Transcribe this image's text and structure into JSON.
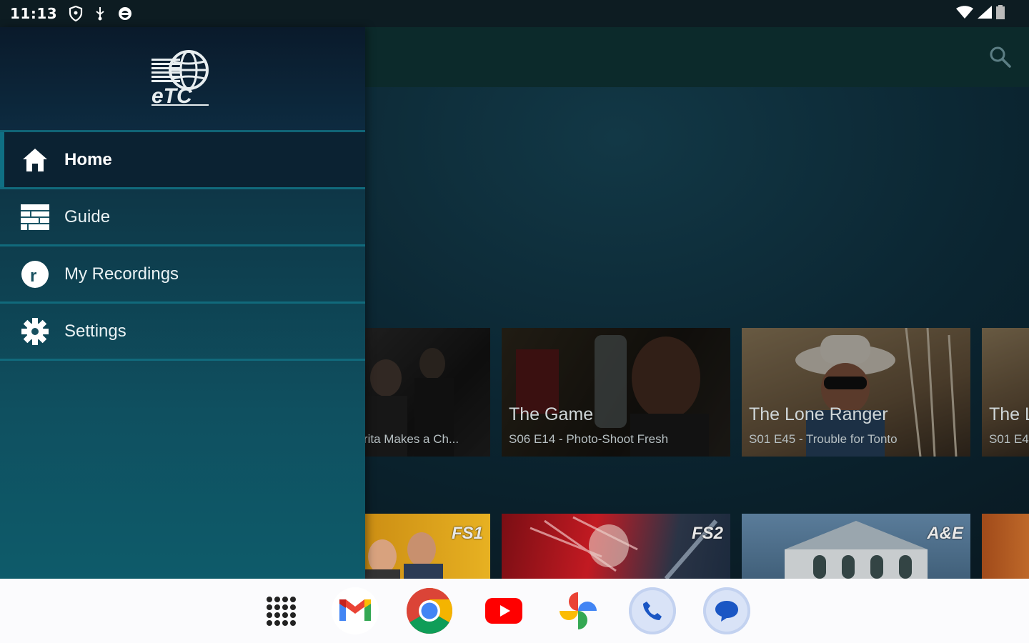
{
  "status_bar": {
    "time": "11:13"
  },
  "drawer": {
    "logo_alt": "ETC",
    "items": [
      {
        "label": "Home",
        "icon": "home-icon",
        "active": true
      },
      {
        "label": "Guide",
        "icon": "guide-icon",
        "active": false
      },
      {
        "label": "My Recordings",
        "icon": "recordings-icon",
        "active": false
      },
      {
        "label": "Settings",
        "icon": "gear-icon",
        "active": false
      }
    ]
  },
  "content": {
    "row1": [
      {
        "title": "",
        "subtitle": "ñorita Makes a Ch..."
      },
      {
        "title": "The Game",
        "subtitle": "S06 E14 - Photo-Shoot Fresh"
      },
      {
        "title": "The Lone Ranger",
        "subtitle": "S01 E45 - Trouble for Tonto"
      },
      {
        "title": "The L",
        "subtitle": "S01 E4"
      }
    ],
    "row2": [
      {
        "channel": "FS1"
      },
      {
        "channel": "FS2"
      },
      {
        "channel": "A&E"
      },
      {
        "channel": ""
      }
    ]
  },
  "dock": {
    "apps": [
      "app-drawer",
      "gmail",
      "chrome",
      "youtube",
      "photos",
      "phone",
      "messages"
    ]
  },
  "colors": {
    "accent": "#116a7c",
    "drawer_top": "#0c2236",
    "drawer_bottom": "#0e5b6a",
    "dock_bg": "#fbfbfd"
  }
}
